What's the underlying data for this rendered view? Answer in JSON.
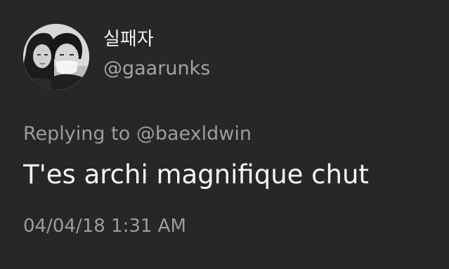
{
  "tweet": {
    "display_name": "실패자",
    "handle": "@gaarunks",
    "replying_prefix": "Replying to",
    "replying_to": "@baexldwin",
    "text": "T'es archi magnifique chut",
    "timestamp": "04/04/18 1:31 AM"
  },
  "colors": {
    "background": "#272727",
    "primary_text": "#f5f5f5",
    "secondary_text": "#9c9c9c"
  },
  "icons": {
    "avatar": "profile-photo"
  }
}
